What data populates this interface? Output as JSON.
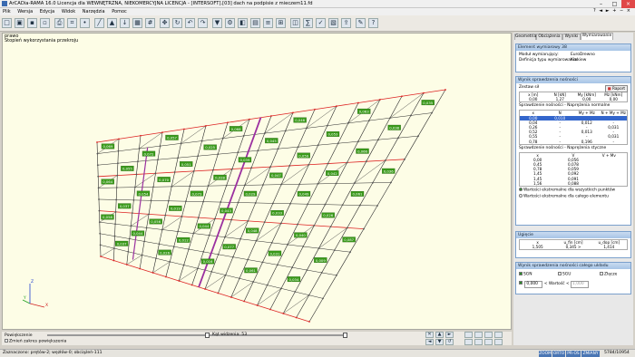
{
  "window": {
    "title": "ArCADia-RAMA 16.0 Licencja dla WEWNĘTRZNA, NIEKOMERCYJNA LICENCJA - [INTERSOFT].[03] dach na podpisie z mieczem11.fd"
  },
  "menu": [
    "Plik",
    "Wersja",
    "Edycja",
    "Widok",
    "Narzędzia",
    "Pomoc"
  ],
  "toolbar": {
    "icons": [
      "new-icon",
      "open-icon",
      "save-icon",
      "save-as-icon",
      "print-icon",
      "structure-icon",
      "node-icon",
      "bar-icon",
      "support-icon",
      "load-icon",
      "table-icon",
      "grid-icon",
      "move-icon",
      "rotate-icon",
      "undo-icon",
      "redo-icon",
      "filter-icon",
      "settings-icon",
      "view-icon",
      "display-icon",
      "layer-icon",
      "section-icon",
      "result-icon",
      "calc-icon",
      "check-icon",
      "report-icon",
      "export-icon",
      "tools-icon",
      "help-icon"
    ]
  },
  "view": {
    "label_line1": "prawo",
    "label_line2": "Stopień wykorzystania przekroju",
    "axis_x": "X",
    "axis_y": "Y",
    "axis_z": "Z"
  },
  "bottom": {
    "label_powiekszenie": "Powiększenie",
    "zoom_value": "Kąt widzenia: 53",
    "change_label": "Zmień zakres powiększenia"
  },
  "tabs": [
    "Geometria",
    "Obciążenia",
    "Wyniki",
    "Wymiarowanie"
  ],
  "element_panel": {
    "header": "Element wymiarowy 38",
    "model_label": "Moduł wymiarujący:",
    "model_value": "EuroDrewno",
    "def_label": "Definicja typu wymiarowania:",
    "def_value": "Krokiew"
  },
  "results_panel": {
    "header": "Wynik sprawdzenia nośności",
    "zestaw": "Zestaw sił",
    "report_button": "Raport",
    "force_headers": [
      "x [m]",
      "N [kN]",
      "My [kNm]",
      "Mz [kNm]"
    ],
    "force_row": [
      "0,00",
      "1,27",
      "0,00",
      "0,00"
    ],
    "normal_title": "Sprawdzenie nośności - Naprężenia normalne",
    "normal_headers": [
      "x",
      "N",
      "My + Mz",
      "N + My + Mz"
    ],
    "normal_rows": [
      [
        "0,00",
        "0,010",
        "",
        ""
      ],
      [
        "0,04",
        "-",
        "0,012",
        "-"
      ],
      [
        "0,26",
        "-",
        "-",
        "0,031"
      ],
      [
        "0,52",
        "-",
        "0,013",
        "-"
      ],
      [
        "0,55",
        "-",
        "-",
        "0,031"
      ],
      [
        "0,78",
        "-",
        "0,196",
        "-"
      ]
    ],
    "shear_title": "Sprawdzenie nośności - Naprężenia styczne",
    "shear_headers": [
      "x",
      "V",
      "V + Mv"
    ],
    "shear_rows": [
      [
        "0,00",
        "0,056",
        ""
      ],
      [
        "0,45",
        "0,078",
        ""
      ],
      [
        "0,78",
        "0,059",
        ""
      ],
      [
        "1,45",
        "0,092",
        ""
      ],
      [
        "1,45",
        "0,091",
        ""
      ],
      [
        "1,56",
        "0,088",
        ""
      ]
    ],
    "opt1": "Wartości ekstremalne dla wszystkich punktów",
    "opt2": "Wartości ekstremalne dla całego elementu"
  },
  "deflection_panel": {
    "header": "Ugięcie",
    "headers": [
      "x",
      "u_fin [cm]",
      "u_dop [cm]"
    ],
    "row": [
      "1,505",
      "0,345 >",
      "1,414"
    ]
  },
  "global_panel": {
    "header": "Wynik sprawdzenia nośności całego układu",
    "sgn": "SGN",
    "sgu": "SGU",
    "zlecie": "Złącze",
    "value_field": "0,000",
    "wartosc_label": "< Wartość <",
    "value_field2": "1,000"
  },
  "status": {
    "left": "Zaznaczono: prętów-2; węzłów-0; obciążeń-111",
    "boxes": [
      "ZOOM",
      "ORTO",
      "PR-OS",
      "ZMIANY"
    ],
    "right": "5784/10954"
  },
  "colors": {
    "label_bg": "#3a9a1a",
    "label_selected": "#e6e61a",
    "bar_main": "#2a2a2a",
    "bar_red": "#dd2222",
    "bar_highlight": "#9b30a0",
    "view_bg": "#fdfde6"
  },
  "labels": [
    "0,037",
    "0,026",
    "0,016",
    "0,061",
    "0,034",
    "0,044",
    "0,012",
    "0,077",
    "0,031",
    "0,009",
    "0,058",
    "0,056",
    "0,044",
    "0,048",
    "0,040",
    "0,087",
    "0,037",
    "0,019",
    "0,043",
    "0,033",
    "0,026",
    "0,054",
    "0,073",
    "0,029",
    "0,049",
    "0,061",
    "0,064",
    "0,070",
    "0,028",
    "0,047",
    "0,042",
    "0,036",
    "0,055",
    "0,051",
    "0,039",
    "0,059",
    "0,066",
    "0,072",
    "0,025",
    "0,045",
    "0,053",
    "0,038",
    "0,069",
    "0,057",
    "0,068",
    "0,046",
    "0,063",
    "0,035",
    "0,050",
    "0,034"
  ]
}
